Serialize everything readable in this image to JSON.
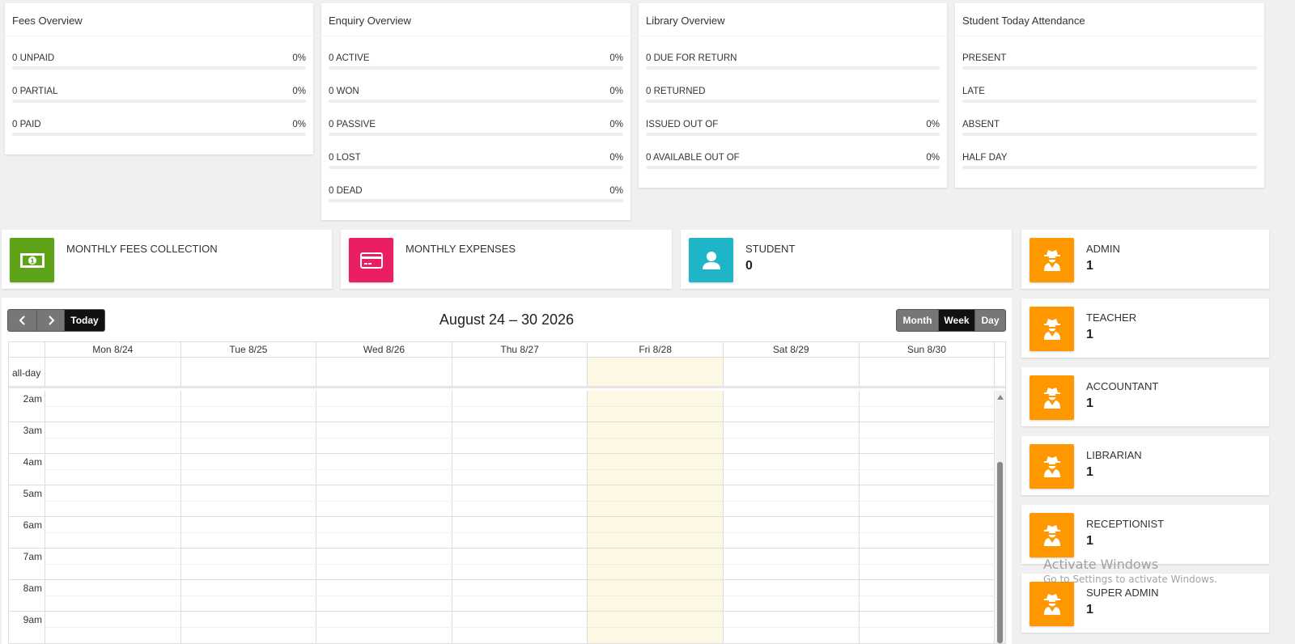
{
  "overview": {
    "fees": {
      "title": "Fees Overview",
      "rows": [
        {
          "label": "0 UNPAID",
          "percent": "0%",
          "fill": 0
        },
        {
          "label": "0 PARTIAL",
          "percent": "0%",
          "fill": 0
        },
        {
          "label": "0 PAID",
          "percent": "0%",
          "fill": 0
        }
      ]
    },
    "enquiry": {
      "title": "Enquiry Overview",
      "rows": [
        {
          "label": "0 ACTIVE",
          "percent": "0%",
          "fill": 0
        },
        {
          "label": "0 WON",
          "percent": "0%",
          "fill": 0
        },
        {
          "label": "0 PASSIVE",
          "percent": "0%",
          "fill": 0
        },
        {
          "label": "0 LOST",
          "percent": "0%",
          "fill": 0
        },
        {
          "label": "0 DEAD",
          "percent": "0%",
          "fill": 0
        }
      ]
    },
    "library": {
      "title": "Library Overview",
      "rows": [
        {
          "label": "0 DUE FOR RETURN",
          "percent": "",
          "fill": 0
        },
        {
          "label": "0 RETURNED",
          "percent": "",
          "fill": 0
        },
        {
          "label": "ISSUED OUT OF",
          "percent": "0%",
          "fill": 0
        },
        {
          "label": "0 AVAILABLE OUT OF",
          "percent": "0%",
          "fill": 0
        }
      ]
    },
    "attendance": {
      "title": "Student Today Attendance",
      "rows": [
        {
          "label": "PRESENT",
          "percent": "",
          "fill": 0
        },
        {
          "label": "LATE",
          "percent": "",
          "fill": 0
        },
        {
          "label": "ABSENT",
          "percent": "",
          "fill": 0
        },
        {
          "label": "HALF DAY",
          "percent": "",
          "fill": 0
        }
      ]
    }
  },
  "info_boxes": {
    "fees_collection": {
      "label": "MONTHLY FEES COLLECTION",
      "value": "",
      "icon": "money-icon",
      "color": "#5fa318"
    },
    "expenses": {
      "label": "MONTHLY EXPENSES",
      "value": "",
      "icon": "credit-card-icon",
      "color": "#e91e63"
    },
    "student": {
      "label": "STUDENT",
      "value": "0",
      "icon": "user-icon",
      "color": "#1fb5c9"
    }
  },
  "staff": [
    {
      "label": "ADMIN",
      "value": "1"
    },
    {
      "label": "TEACHER",
      "value": "1"
    },
    {
      "label": "ACCOUNTANT",
      "value": "1"
    },
    {
      "label": "LIBRARIAN",
      "value": "1"
    },
    {
      "label": "RECEPTIONIST",
      "value": "1"
    },
    {
      "label": "SUPER ADMIN",
      "value": "1"
    }
  ],
  "staff_icon": "user-secret-icon",
  "staff_color": "#ff9800",
  "calendar": {
    "title": "August 24 – 30 2026",
    "today_label": "Today",
    "views": {
      "month": "Month",
      "week": "Week",
      "day": "Day"
    },
    "active_view": "Week",
    "allday_label": "all-day",
    "days": [
      "Mon 8/24",
      "Tue 8/25",
      "Wed 8/26",
      "Thu 8/27",
      "Fri 8/28",
      "Sat 8/29",
      "Sun 8/30"
    ],
    "today_index": 4,
    "times": [
      "2am",
      "3am",
      "4am",
      "5am",
      "6am",
      "7am",
      "8am",
      "9am"
    ]
  },
  "watermark": {
    "line1": "Activate Windows",
    "line2": "Go to Settings to activate Windows."
  }
}
